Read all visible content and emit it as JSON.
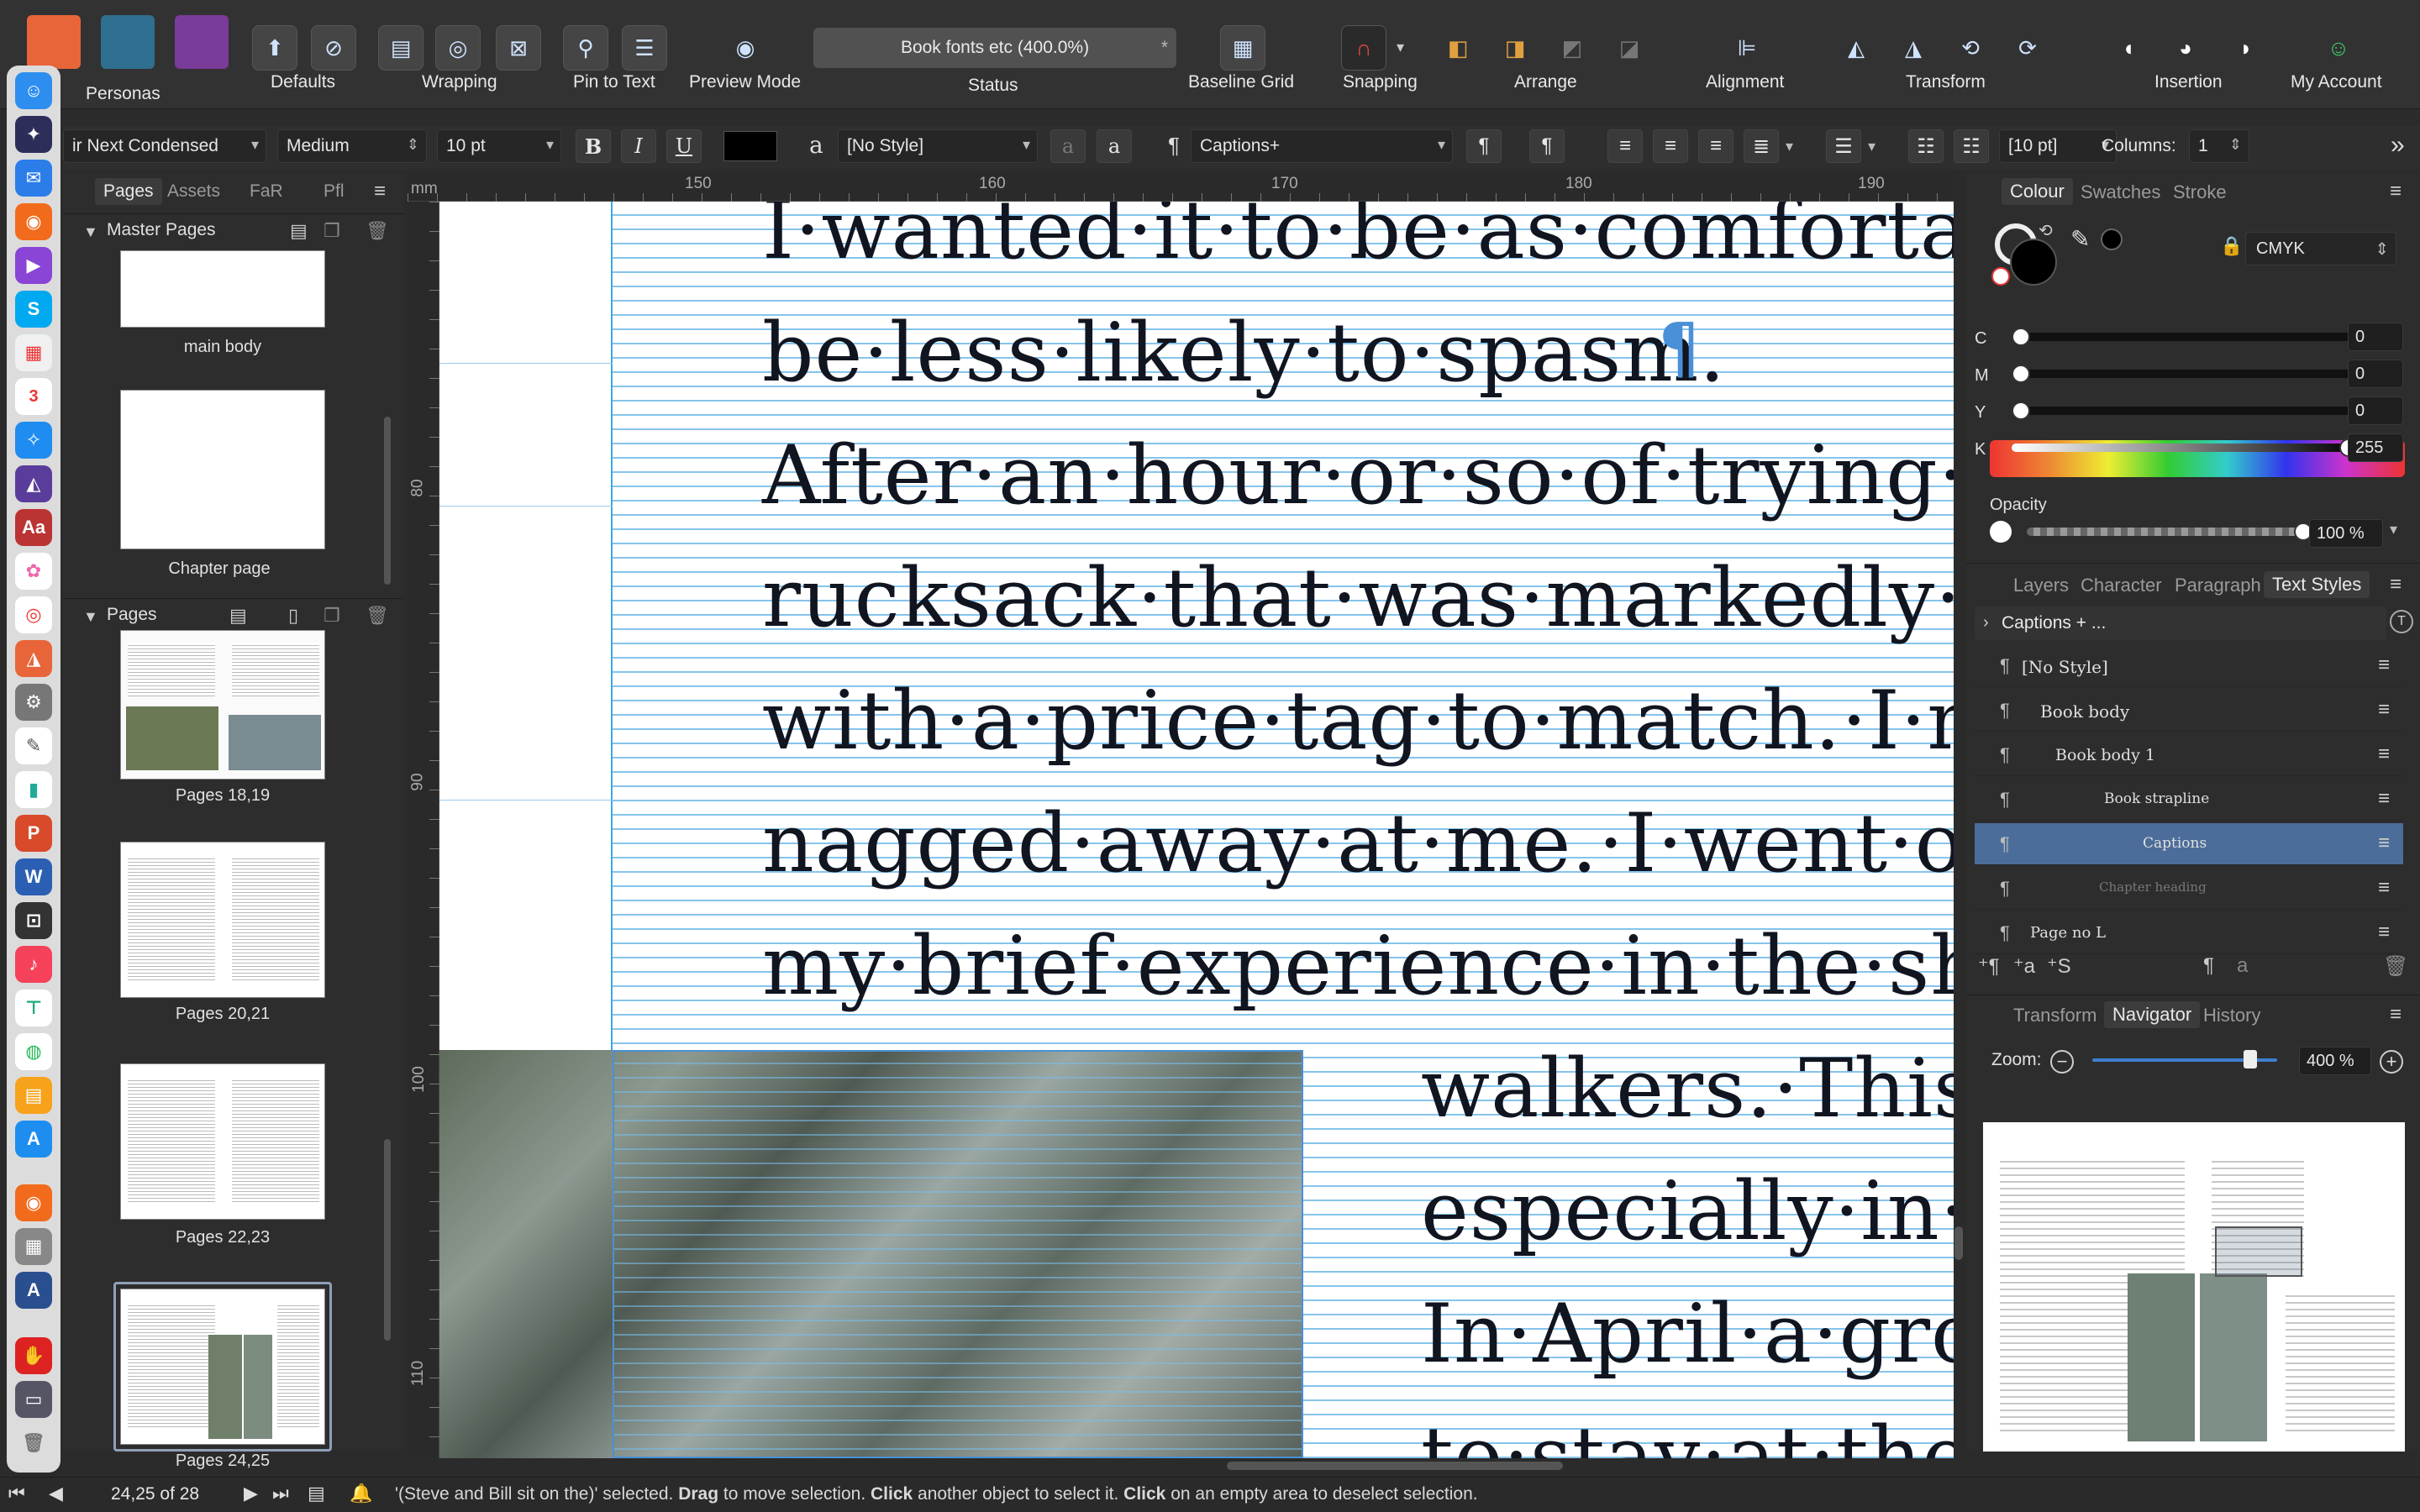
{
  "toolbar": {
    "persona_label": "Personas",
    "labels": {
      "defaults": "Defaults",
      "wrapping": "Wrapping",
      "pin_to_text": "Pin to Text",
      "preview_mode": "Preview Mode",
      "status": "Status",
      "baseline_grid": "Baseline Grid",
      "snapping": "Snapping",
      "arrange": "Arrange",
      "alignment": "Alignment",
      "transform": "Transform",
      "insertion": "Insertion",
      "my_account": "My Account"
    },
    "status_value": "Book fonts etc (400.0%)",
    "status_mark": "*"
  },
  "context_bar": {
    "font_family": "ir Next Condensed",
    "font_weight": "Medium",
    "font_size": "10 pt",
    "bold": "B",
    "italic": "I",
    "underline": "U",
    "char_style_icon": "a",
    "char_style": "[No Style]",
    "para_style_icon": "¶",
    "para_style": "Captions+",
    "spacing": "[10 pt]",
    "columns_label": "Columns:",
    "columns_value": "1",
    "overflow": "»"
  },
  "left_panel": {
    "tabs": [
      "Pages",
      "Assets",
      "FaR",
      "Pfl"
    ],
    "master_pages_header": "Master Pages",
    "pages_header": "Pages",
    "master_pages": [
      "main body",
      "Chapter page"
    ],
    "pages": [
      "Pages 18,19",
      "Pages 20,21",
      "Pages 22,23",
      "Pages 24,25"
    ]
  },
  "rulers": {
    "unit": "mm",
    "top": [
      "150",
      "160",
      "170",
      "180",
      "190"
    ],
    "left": [
      "80",
      "90",
      "100",
      "110"
    ]
  },
  "document": {
    "lines": [
      "I·wanted·it·to·be·as·comfortab",
      "be·less·likely·to·spasm.",
      "After·an·hour·or·so·of·trying·o",
      "rucksack·that·was·markedly·be",
      "with·a·price·tag·to·match.·I·m",
      "nagged·away·at·me.·I·went·on",
      "my·brief·experience·in·the·sho"
    ],
    "lines_right": [
      "walkers.·This",
      "especially·in·m",
      "In·April·a·gro",
      "to·stay·at·the"
    ],
    "pilcrow": "¶"
  },
  "right_panel": {
    "colour_tabs": [
      "Colour",
      "Swatches",
      "Stroke"
    ],
    "color_model": "CMYK",
    "channels": [
      {
        "label": "C",
        "value": "0",
        "pct": 0
      },
      {
        "label": "M",
        "value": "0",
        "pct": 0
      },
      {
        "label": "Y",
        "value": "0",
        "pct": 0
      },
      {
        "label": "K",
        "value": "255",
        "pct": 100
      }
    ],
    "opacity_label": "Opacity",
    "opacity_value": "100 %",
    "opacity_pct": 100,
    "style_tabs": [
      "Layers",
      "Character",
      "Paragraph",
      "Text Styles"
    ],
    "style_group": "Captions + ...",
    "styles": [
      "[No Style]",
      "Book body",
      "Book body 1",
      "Book strapline",
      "Captions",
      "Chapter heading",
      "Page no L"
    ],
    "selected_style": "Captions",
    "nav_tabs": [
      "Transform",
      "Navigator",
      "History"
    ],
    "zoom_label": "Zoom:",
    "zoom_value": "400 %",
    "zoom_pct": 88
  },
  "status_bar": {
    "page_indicator": "24,25 of 28",
    "message_pre": "'(Steve and Bill sit on the)' selected. ",
    "drag": "Drag",
    "msg1": " to move selection. ",
    "click": "Click",
    "msg2": " another object to select it. ",
    "click2": "Click",
    "msg3": " on an empty area to deselect selection."
  },
  "colors": {
    "accent_selection": "#4c6d99",
    "baseline_grid": "#3ea7e8",
    "panel_bg": "#2d2d2d",
    "toolbar_bg": "#323232"
  }
}
